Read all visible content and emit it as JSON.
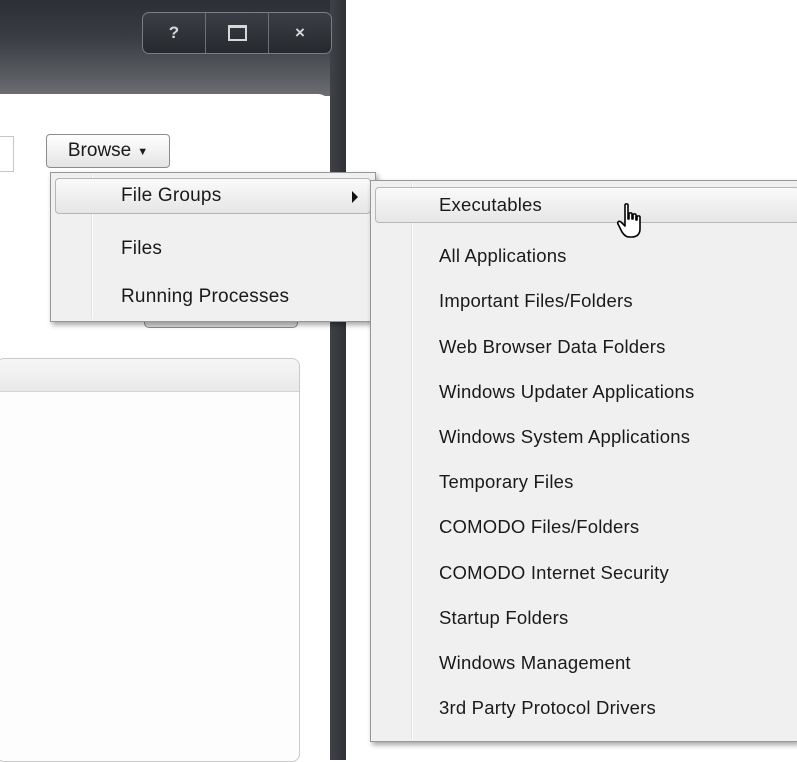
{
  "window": {
    "buttons": [
      {
        "name": "help",
        "glyph": "?"
      },
      {
        "name": "maximize",
        "glyph": ""
      },
      {
        "name": "close",
        "glyph": "×"
      }
    ]
  },
  "toolbar": {
    "browse_label": "Browse",
    "browse_caret": "▼"
  },
  "browse_menu": {
    "items": [
      {
        "label": "File Groups",
        "has_submenu": true,
        "highlighted": true
      },
      {
        "label": "Files"
      },
      {
        "label": "Running Processes"
      }
    ]
  },
  "file_groups_menu": {
    "items": [
      {
        "label": "Executables",
        "highlighted": true
      },
      {
        "label": "All Applications"
      },
      {
        "label": "Important Files/Folders"
      },
      {
        "label": "Web Browser Data Folders"
      },
      {
        "label": "Windows Updater Applications"
      },
      {
        "label": "Windows System Applications"
      },
      {
        "label": "Temporary Files"
      },
      {
        "label": "COMODO Files/Folders"
      },
      {
        "label": "COMODO Internet Security"
      },
      {
        "label": "Startup Folders"
      },
      {
        "label": "Windows Management"
      },
      {
        "label": "3rd Party Protocol Drivers"
      }
    ]
  },
  "cursor": {
    "icon": "hand-pointer-icon"
  },
  "colors": {
    "frame": "#2c2f35",
    "menu_bg": "#f0f0f0",
    "highlight": "#e6e6e6"
  }
}
